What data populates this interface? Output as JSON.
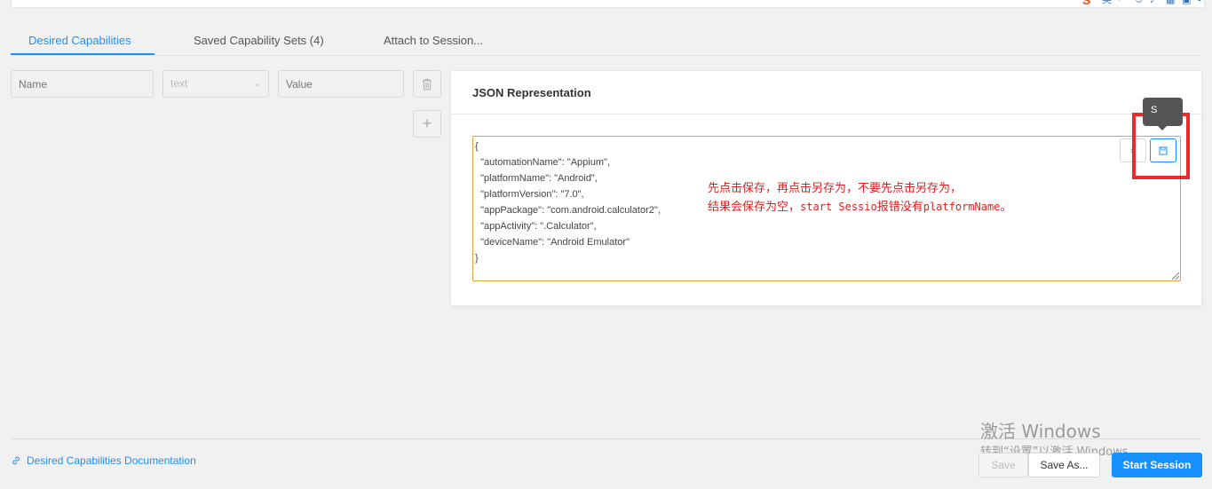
{
  "tabs": [
    {
      "label": "Desired Capabilities"
    },
    {
      "label": "Saved Capability Sets (4)"
    },
    {
      "label": "Attach to Session..."
    }
  ],
  "capability_row": {
    "name_placeholder": "Name",
    "type_value": "text",
    "value_placeholder": "Value"
  },
  "json_panel": {
    "title": "JSON Representation",
    "lines": [
      "{",
      "  \"automationName\": \"Appium\",",
      "  \"platformName\": \"Android\",",
      "  \"platformVersion\": \"7.0\",",
      "  \"appPackage\": \"com.android.calculator2\",",
      "  \"appActivity\": \".Calculator\",",
      "  \"deviceName\": \"Android Emulator\"",
      "}"
    ],
    "tooltip": "S"
  },
  "annotation": {
    "line1": "先点击保存，再点击另存为，不要先点击另存为，",
    "line2_prefix": "结果会保存为空，",
    "line2_mono": "start Sessio",
    "line2_mid": "报错没有",
    "line2_mono2": "platformName",
    "line2_suffix": "。"
  },
  "footer": {
    "doc_link": "Desired Capabilities Documentation",
    "save": "Save",
    "save_as": "Save As...",
    "start_session": "Start Session"
  },
  "watermark": {
    "line1": "激活 Windows",
    "line2": "转到“设置”以激活 Windows。"
  },
  "colors": {
    "accent": "#1890ff",
    "annotation_red": "#e02020",
    "json_border": "#d9a441"
  }
}
